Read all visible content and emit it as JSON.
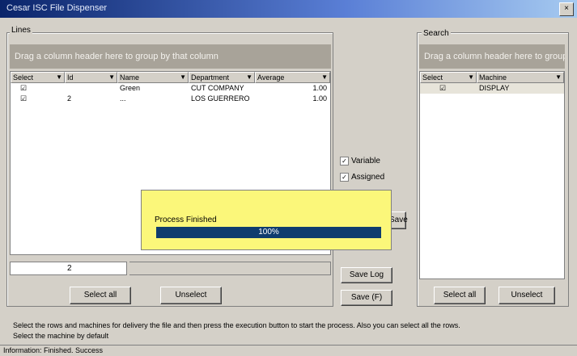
{
  "window": {
    "title": "Cesar ISC File Dispenser",
    "close_glyph": "×"
  },
  "lines_panel": {
    "group_label": "Lines",
    "header_text": "Drag a column header here to group by that column",
    "columns": [
      "Select",
      "Id",
      "Name",
      "Department",
      "Average"
    ],
    "rows": [
      {
        "select": "☑",
        "id": "",
        "name": "Green",
        "department": "CUT COMPANY",
        "average": "1.00"
      },
      {
        "select": "☑",
        "id": "2",
        "name": "...",
        "department": "LOS GUERRERO",
        "average": "1.00"
      }
    ],
    "count_value": "2",
    "select_all": "Select all",
    "unselect": "Unselect"
  },
  "search_panel": {
    "group_label": "Search",
    "header_text": "Drag a column header here to group",
    "columns": [
      "Select",
      "Machine"
    ],
    "rows": [
      {
        "select": "☑",
        "machine": "DISPLAY"
      }
    ],
    "select_all": "Select all",
    "unselect": "Unselect"
  },
  "middle": {
    "checkbox_1": "Variable",
    "checkbox_2": "Assigned",
    "button_1": "Save",
    "button_2": "Save Log",
    "button_3": "Save (F)"
  },
  "popup": {
    "label": "Process Finished",
    "progress_percent": 100,
    "progress_text": "100%"
  },
  "footer": {
    "line_1": "Select the rows and machines for delivery the file and then press the execution button to start the process. Also you can select all the rows.",
    "line_2": "Select the machine by default"
  },
  "status_bar": {
    "text": "Information: Finished. Success"
  }
}
